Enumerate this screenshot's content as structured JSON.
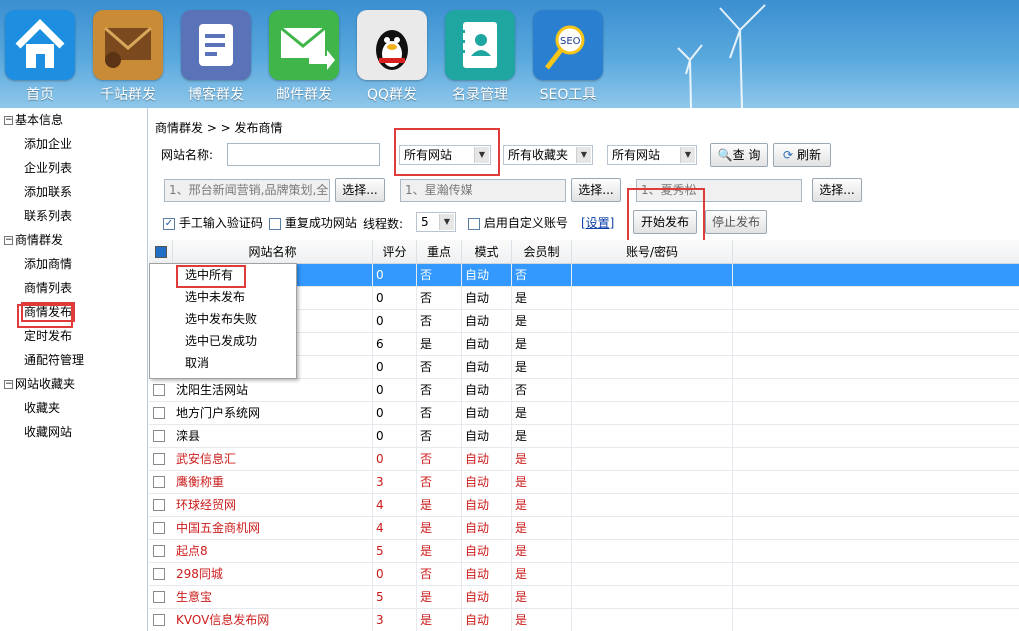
{
  "nav": [
    {
      "label": "首页",
      "icon": "home-icon",
      "color": "#1e8fe0"
    },
    {
      "label": "千站群发",
      "icon": "mail-envelope-icon",
      "color": "#c98b36"
    },
    {
      "label": "博客群发",
      "icon": "document-icon",
      "color": "#5a72b8"
    },
    {
      "label": "邮件群发",
      "icon": "email-send-icon",
      "color": "#3fb54a"
    },
    {
      "label": "QQ群发",
      "icon": "qq-penguin-icon",
      "color": "#eaeaea"
    },
    {
      "label": "名录管理",
      "icon": "contacts-book-icon",
      "color": "#1fa6a0"
    },
    {
      "label": "SEO工具",
      "icon": "seo-magnifier-icon",
      "color": "#2a7fd0"
    }
  ],
  "sidebar": [
    {
      "group": "基本信息",
      "items": [
        "添加企业",
        "企业列表",
        "添加联系",
        "联系列表"
      ]
    },
    {
      "group": "商情群发",
      "items": [
        "添加商情",
        "商情列表",
        "商情发布",
        "定时发布",
        "通配符管理"
      ]
    },
    {
      "group": "网站收藏夹",
      "items": [
        "收藏夹",
        "收藏网站"
      ]
    }
  ],
  "active_sidebar_item": "商情发布",
  "breadcrumb": "商情群发 > > 发布商情",
  "form": {
    "site_name_label": "网站名称:",
    "site_name_value": "",
    "filter1": "所有网站",
    "filter2": "所有收藏夹",
    "filter3": "所有网站",
    "query_button": "查 询",
    "refresh_button": "刷新",
    "select_input1": "1、邢台新闻营销,品牌策划,全",
    "select_input2": "1、星瀚传媒",
    "select_input3": "1、夏秀松",
    "select_button": "选择...",
    "manual_captcha": "手工输入验证码",
    "repeat_success": "重复成功网站",
    "threads_label": "线程数:",
    "threads_value": "5",
    "custom_account": "启用自定义账号",
    "settings_link": "[设置]",
    "start_button": "开始发布",
    "stop_button": "停止发布"
  },
  "grid": {
    "headers": [
      "网站名称",
      "评分",
      "重点",
      "模式",
      "会员制",
      "账号/密码"
    ],
    "rows": [
      {
        "name": "",
        "score": "0",
        "key": "否",
        "mode": "自动",
        "member": "否",
        "red": false,
        "selected": true
      },
      {
        "name": "",
        "score": "0",
        "key": "否",
        "mode": "自动",
        "member": "是",
        "red": false
      },
      {
        "name": "",
        "score": "0",
        "key": "否",
        "mode": "自动",
        "member": "是",
        "red": false
      },
      {
        "name": "",
        "score": "6",
        "key": "是",
        "mode": "自动",
        "member": "是",
        "red": false
      },
      {
        "name": "",
        "score": "0",
        "key": "否",
        "mode": "自动",
        "member": "是",
        "red": false
      },
      {
        "name": "沈阳生活网站",
        "score": "0",
        "key": "否",
        "mode": "自动",
        "member": "否",
        "red": false
      },
      {
        "name": "地方门户系统网",
        "score": "0",
        "key": "否",
        "mode": "自动",
        "member": "是",
        "red": false
      },
      {
        "name": "滦县",
        "score": "0",
        "key": "否",
        "mode": "自动",
        "member": "是",
        "red": false
      },
      {
        "name": "武安信息汇",
        "score": "0",
        "key": "否",
        "mode": "自动",
        "member": "是",
        "red": true
      },
      {
        "name": "鹰衡称重",
        "score": "3",
        "key": "否",
        "mode": "自动",
        "member": "是",
        "red": true
      },
      {
        "name": "环球经贸网",
        "score": "4",
        "key": "是",
        "mode": "自动",
        "member": "是",
        "red": true
      },
      {
        "name": "中国五金商机网",
        "score": "4",
        "key": "是",
        "mode": "自动",
        "member": "是",
        "red": true
      },
      {
        "name": "起点8",
        "score": "5",
        "key": "是",
        "mode": "自动",
        "member": "是",
        "red": true
      },
      {
        "name": "298同城",
        "score": "0",
        "key": "否",
        "mode": "自动",
        "member": "是",
        "red": true
      },
      {
        "name": "生意宝",
        "score": "5",
        "key": "是",
        "mode": "自动",
        "member": "是",
        "red": true
      },
      {
        "name": "KVOV信息发布网",
        "score": "3",
        "key": "是",
        "mode": "自动",
        "member": "是",
        "red": true
      }
    ]
  },
  "context_menu": [
    "选中所有",
    "选中未发布",
    "选中发布失败",
    "选中已发成功",
    "取消"
  ],
  "colors": {
    "selected_row": "#3399ff",
    "highlight_box": "#e03b3b",
    "red_text": "#cc1b1b"
  }
}
